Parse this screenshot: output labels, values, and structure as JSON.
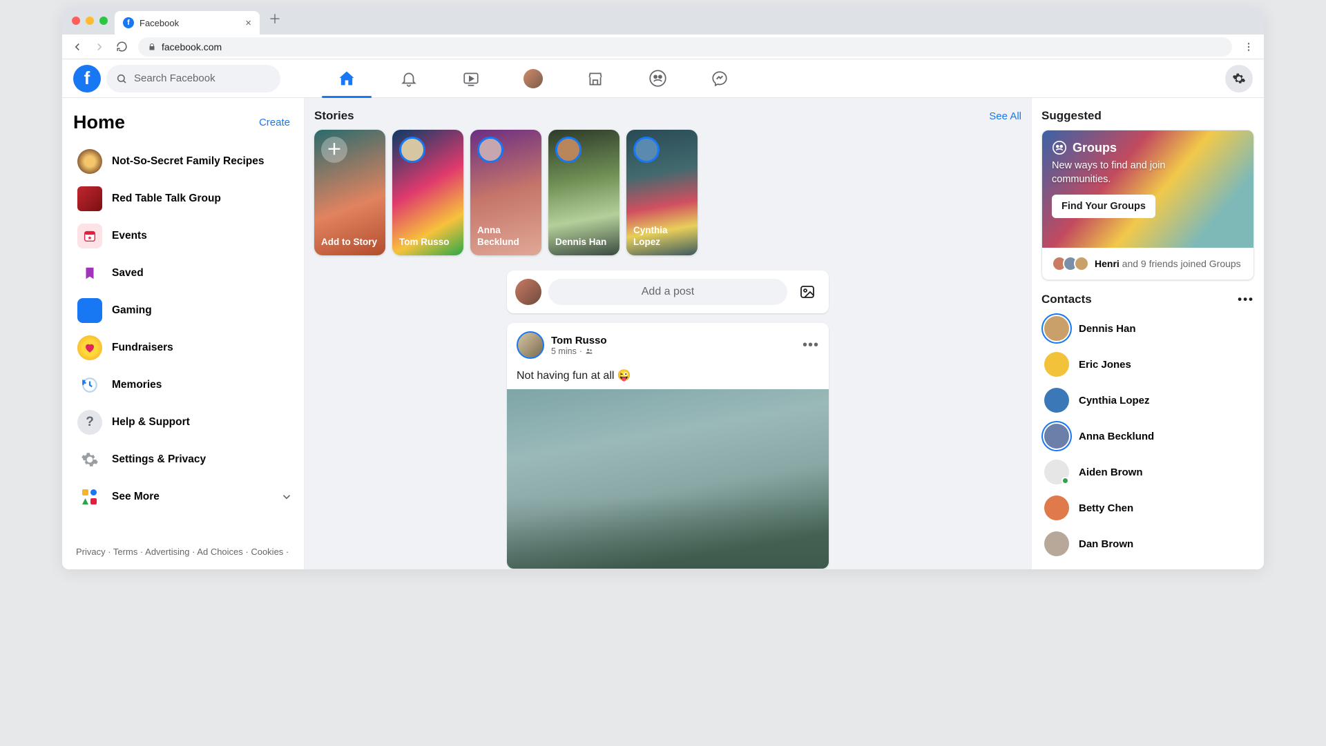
{
  "browser": {
    "tab_title": "Facebook",
    "url": "facebook.com"
  },
  "header": {
    "search_placeholder": "Search Facebook"
  },
  "left": {
    "title": "Home",
    "create": "Create",
    "items": [
      {
        "label": "Not-So-Secret Family Recipes"
      },
      {
        "label": "Red Table Talk Group"
      },
      {
        "label": "Events"
      },
      {
        "label": "Saved"
      },
      {
        "label": "Gaming"
      },
      {
        "label": "Fundraisers"
      },
      {
        "label": "Memories"
      },
      {
        "label": "Help & Support"
      },
      {
        "label": "Settings & Privacy"
      },
      {
        "label": "See More"
      }
    ],
    "footer": "Privacy · Terms · Advertising · Ad Choices · Cookies ·"
  },
  "stories": {
    "title": "Stories",
    "see_all": "See All",
    "items": [
      {
        "label": "Add to Story"
      },
      {
        "label": "Tom Russo"
      },
      {
        "label": "Anna Becklund"
      },
      {
        "label": "Dennis Han"
      },
      {
        "label": "Cynthia Lopez"
      }
    ]
  },
  "composer": {
    "placeholder": "Add a post"
  },
  "post": {
    "author": "Tom Russo",
    "time": "5 mins",
    "text": "Not having fun at all 😜"
  },
  "suggested": {
    "title": "Suggested",
    "card_title": "Groups",
    "card_sub": "New ways to find and join communities.",
    "cta": "Find Your Groups",
    "foot_name": "Henri",
    "foot_rest": " and 9 friends joined Groups"
  },
  "contacts": {
    "title": "Contacts",
    "items": [
      {
        "name": "Dennis Han",
        "color": "#caa06a",
        "ring": true
      },
      {
        "name": "Eric Jones",
        "color": "#f2c23a"
      },
      {
        "name": "Cynthia Lopez",
        "color": "#3a78b8"
      },
      {
        "name": "Anna Becklund",
        "color": "#6b7fa8",
        "ring": true
      },
      {
        "name": "Aiden Brown",
        "color": "#e6e6e6",
        "online": true
      },
      {
        "name": "Betty Chen",
        "color": "#e07a4a"
      },
      {
        "name": "Dan Brown",
        "color": "#b8a89a"
      }
    ]
  }
}
